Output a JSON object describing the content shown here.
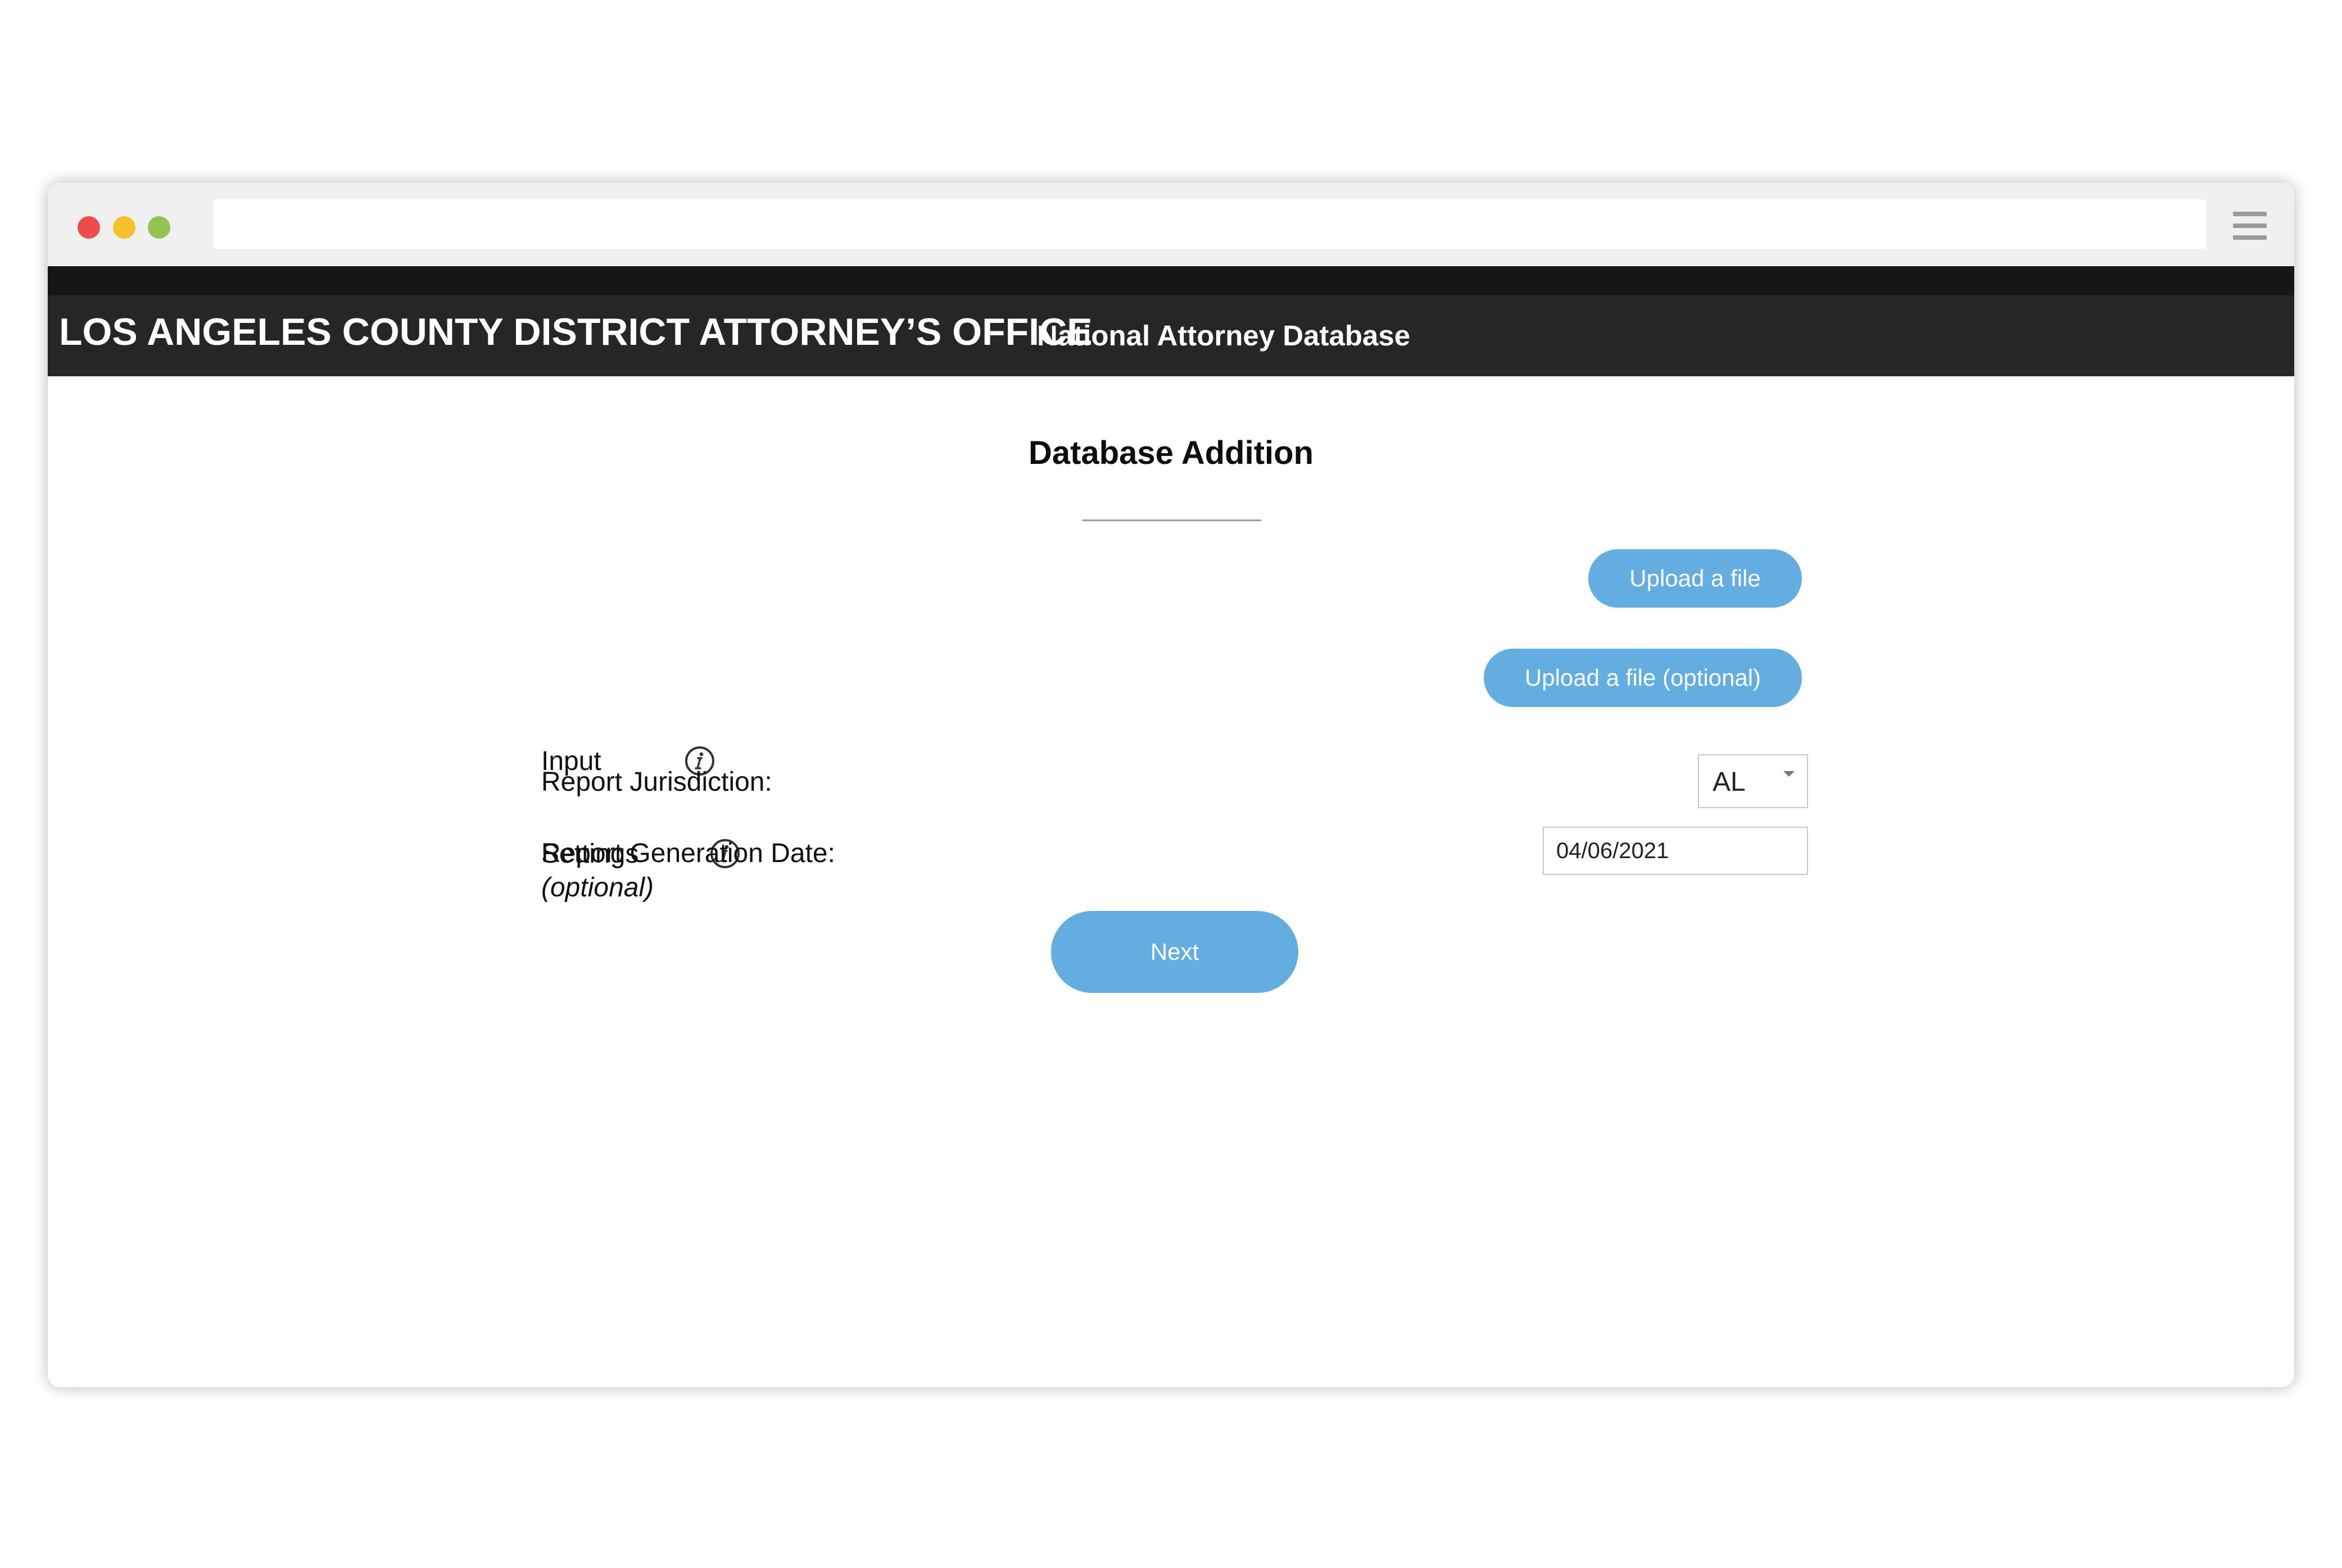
{
  "window": {
    "address_value": "",
    "controls": [
      "close",
      "minimize",
      "maximize"
    ],
    "menu_icon": "hamburger-menu-icon"
  },
  "header": {
    "title": "LOS ANGELES COUNTY DISTRICT ATTORNEY’S OFFICE",
    "subtitle": "National Attorney Database"
  },
  "main": {
    "title": "Database Addition",
    "input": {
      "label": "Input",
      "icon": "info-icon",
      "button_label": "Upload a file"
    },
    "settings": {
      "label": "Settings",
      "sublabel": "(optional)",
      "icon": "info-icon",
      "button_label": "Upload a file (optional)"
    },
    "jurisdiction": {
      "label": "Report Jurisdiction:",
      "selected": "AL"
    },
    "generation_date": {
      "label": "Report Generation Date:",
      "value": "04/06/2021"
    },
    "next_label": "Next"
  },
  "colors": {
    "header_bg": "#262626",
    "top_strip": "#161616",
    "button": "#63ade0",
    "close_dot": "#ee4b4b",
    "minimize_dot": "#f6c02a",
    "maximize_dot": "#92c44f"
  }
}
